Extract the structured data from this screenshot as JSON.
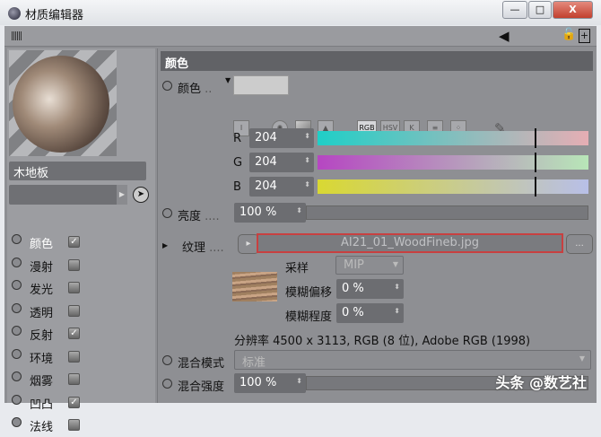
{
  "window": {
    "title": "材质编辑器",
    "minimize": "—",
    "maximize": "□",
    "close": "X"
  },
  "material": {
    "name": "木地板"
  },
  "channels": [
    {
      "label": "颜色",
      "checked": true,
      "active": true
    },
    {
      "label": "漫射",
      "checked": false
    },
    {
      "label": "发光",
      "checked": false
    },
    {
      "label": "透明",
      "checked": false
    },
    {
      "label": "反射",
      "checked": true
    },
    {
      "label": "环境",
      "checked": false
    },
    {
      "label": "烟雾",
      "checked": false
    },
    {
      "label": "凹凸",
      "checked": true
    },
    {
      "label": "法线",
      "checked": false
    }
  ],
  "section": {
    "title": "颜色"
  },
  "color": {
    "label": "颜色",
    "swatch": "#cccccc",
    "modes": [
      "RGB",
      "HSV",
      "K"
    ],
    "r": "204",
    "g": "204",
    "b": "204",
    "r_label": "R",
    "g_label": "G",
    "b_label": "B",
    "fraction": 0.8
  },
  "brightness": {
    "label": "亮度",
    "value": "100 %"
  },
  "texture": {
    "label": "纹理",
    "file": "AI21_01_WoodFineb.jpg",
    "browse": "...",
    "sampling_label": "采样",
    "sampling": "MIP",
    "blur_offset_label": "模糊偏移",
    "blur_offset": "0 %",
    "blur_scale_label": "模糊程度",
    "blur_scale": "0 %",
    "info": "分辨率 4500 x 3113, RGB (8 位), Adobe RGB (1998)"
  },
  "blend_mode": {
    "label": "混合模式",
    "value": "标准"
  },
  "blend_strength": {
    "label": "混合强度",
    "value": "100 %"
  },
  "watermark": "头条 @数艺社"
}
